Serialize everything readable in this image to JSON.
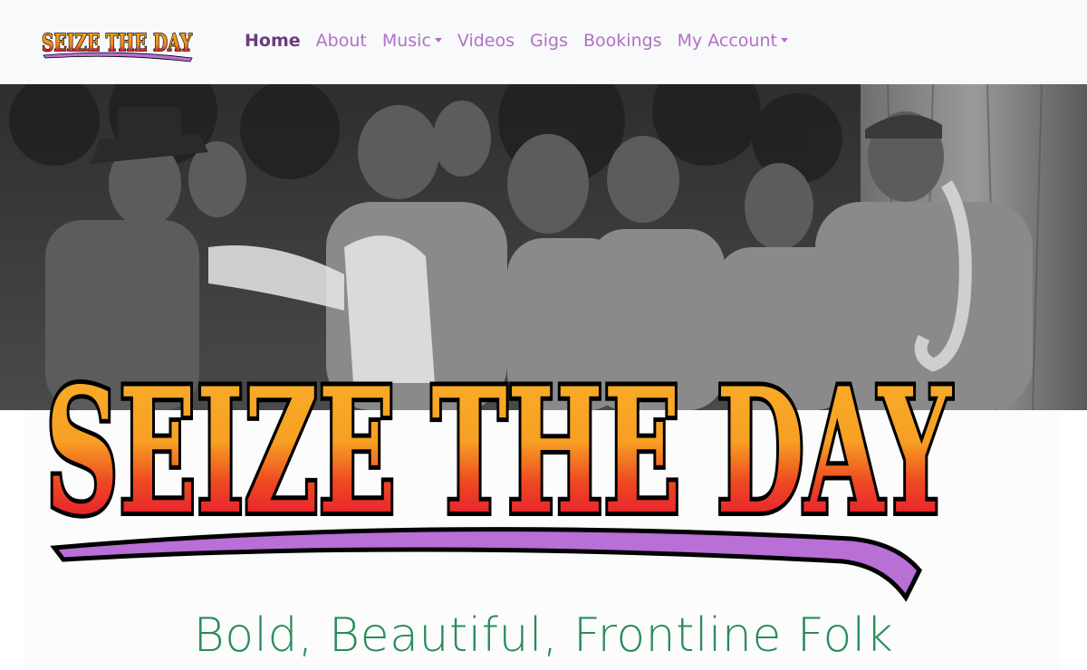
{
  "brand": {
    "logo_text": "SEIZE THE DAY"
  },
  "nav": {
    "items": [
      {
        "label": "Home",
        "active": true,
        "dropdown": false
      },
      {
        "label": "About",
        "active": false,
        "dropdown": false
      },
      {
        "label": "Music",
        "active": false,
        "dropdown": true
      },
      {
        "label": "Videos",
        "active": false,
        "dropdown": false
      },
      {
        "label": "Gigs",
        "active": false,
        "dropdown": false
      },
      {
        "label": "Bookings",
        "active": false,
        "dropdown": false
      },
      {
        "label": "My Account",
        "active": false,
        "dropdown": true
      }
    ]
  },
  "hero": {
    "logo_text": "SEIZE THE DAY",
    "photo_subject": "band-photo"
  },
  "tagline": "Bold, Beautiful, Frontline Folk",
  "colors": {
    "nav_link": "#b36fc7",
    "nav_active": "#6a3d7a",
    "tagline": "#2a8c5a",
    "logo_orange": "#f7a823",
    "logo_red": "#e8272d",
    "logo_purple": "#b86fd6"
  }
}
